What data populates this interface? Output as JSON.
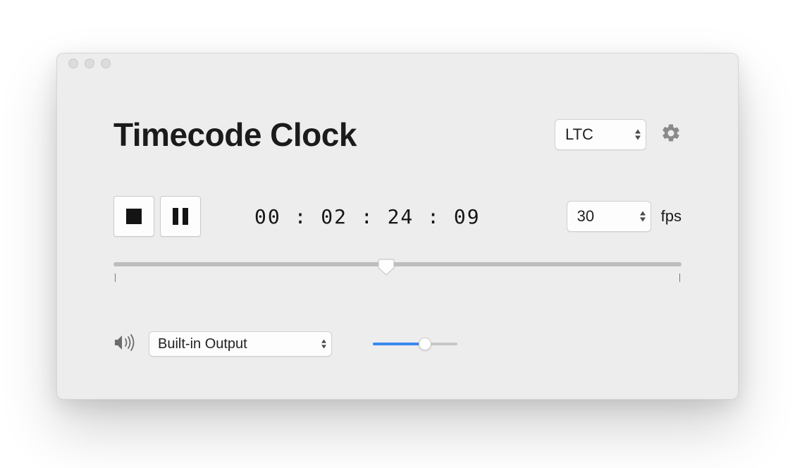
{
  "app": {
    "title": "Timecode Clock"
  },
  "mode": {
    "selected": "LTC"
  },
  "transport": {
    "stop": "stop",
    "pause": "pause"
  },
  "timecode": {
    "display": "00 : 02 : 24 : 09"
  },
  "fps": {
    "selected": "30",
    "label": "fps"
  },
  "timeline": {
    "position_percent": 48
  },
  "audio": {
    "output_selected": "Built-in Output",
    "volume_percent": 62
  }
}
